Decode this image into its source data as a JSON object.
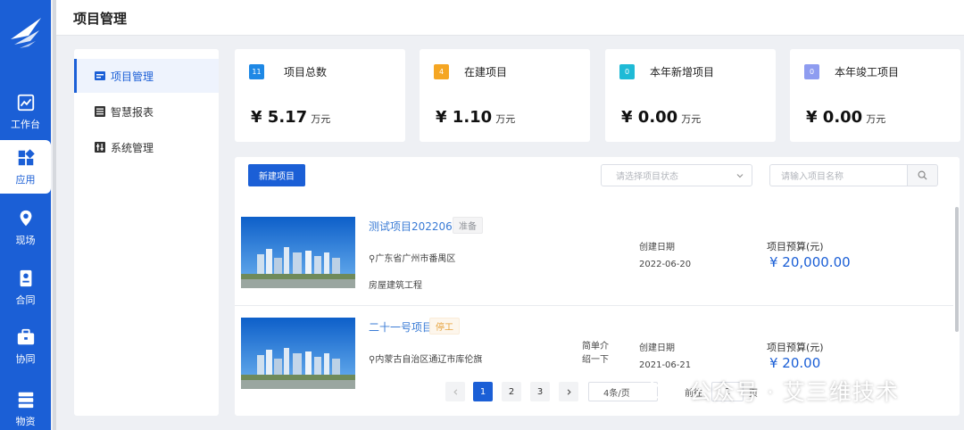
{
  "rail": {
    "items": [
      {
        "label": "工作台",
        "icon": "chart-line-icon"
      },
      {
        "label": "应用",
        "icon": "apps-icon"
      },
      {
        "label": "现场",
        "icon": "location-pin-icon"
      },
      {
        "label": "合同",
        "icon": "contract-icon"
      },
      {
        "label": "协同",
        "icon": "briefcase-icon"
      },
      {
        "label": "物资",
        "icon": "server-stack-icon"
      }
    ],
    "active_index": 1
  },
  "header": {
    "title": "项目管理"
  },
  "submenu": {
    "items": [
      {
        "label": "项目管理",
        "icon": "folder-icon"
      },
      {
        "label": "智慧报表",
        "icon": "report-list-icon"
      },
      {
        "label": "系统管理",
        "icon": "sliders-icon"
      }
    ],
    "active_index": 0
  },
  "stats": [
    {
      "badge": "11",
      "label": "项目总数",
      "value": "¥ 5.17",
      "unit": "万元",
      "color": "#1e88e5"
    },
    {
      "badge": "4",
      "label": "在建项目",
      "value": "¥ 1.10",
      "unit": "万元",
      "color": "#f5a623"
    },
    {
      "badge": "0",
      "label": "本年新增项目",
      "value": "¥ 0.00",
      "unit": "万元",
      "color": "#1fbad6"
    },
    {
      "badge": "0",
      "label": "本年竣工项目",
      "value": "¥ 0.00",
      "unit": "万元",
      "color": "#8e9cf0"
    }
  ],
  "toolbar": {
    "new_button": "新建项目",
    "status_placeholder": "请选择项目状态",
    "search_placeholder": "请输入项目名称"
  },
  "projects": [
    {
      "name": "测试项目20220620",
      "tag": "准备",
      "location": "广东省广州市番禺区",
      "category": "房屋建筑工程",
      "intro": "",
      "date_label": "创建日期",
      "date": "2022-06-20",
      "budget_label": "项目预算(元)",
      "budget": "¥ 20,000.00"
    },
    {
      "name": "二十一号项目",
      "tag": "停工",
      "location": "内蒙古自治区通辽市库伦旗",
      "category": "",
      "intro": "简单介绍一下",
      "date_label": "创建日期",
      "date": "2021-06-21",
      "budget_label": "项目预算(元)",
      "budget": "¥ 20.00"
    }
  ],
  "pagination": {
    "pages": [
      "1",
      "2",
      "3"
    ],
    "active": "1",
    "page_size": "4条/页",
    "goto_label": "前往",
    "goto_value": "1",
    "page_suffix": "页"
  },
  "watermark": {
    "text": "公众号 · 艾三维技术"
  },
  "colors": {
    "brand": "#1b5fd6",
    "tag_prepare": "#909399",
    "tag_stopped": "#e6a23c"
  }
}
